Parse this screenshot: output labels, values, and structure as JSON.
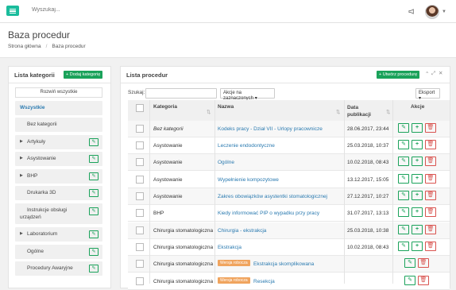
{
  "topbar": {
    "search_placeholder": "Wyszukaj..."
  },
  "page": {
    "title": "Baza procedur",
    "breadcrumbs": [
      "Strona główna",
      "Baza procedur"
    ]
  },
  "categories": {
    "title": "Lista kategorii",
    "add_label": "+ Dodaj kategorię",
    "expand_all": "Rozwiń wszystkie",
    "items": [
      "Wszystkie",
      "Bez kategorii",
      "Artykuły",
      "Asystowanie",
      "BHP",
      "Drukarka 3D",
      "Instrukcje obsługi urządzeń",
      "Laboratorium",
      "Ogólne",
      "Procedury Awaryjne"
    ]
  },
  "procedures": {
    "title": "Lista procedur",
    "create_label": "+ Utwórz procedurę",
    "search_label": "Szukaj:",
    "bulk_label": "Akcje na zaznaczonych",
    "export_label": "Eksport",
    "columns": [
      "Kategoria",
      "Nazwa",
      "Data publikacji",
      "Akcje"
    ],
    "badge_label": "Wersja robocza",
    "rows": [
      {
        "category": "Bez kategorii",
        "name": "Kodeks pracy - Dział VII - Urlopy pracownicze",
        "date": "28.06.2017, 23:44"
      },
      {
        "category": "Asystowanie",
        "name": "Leczenie endodontyczne",
        "date": "25.03.2018, 10:37"
      },
      {
        "category": "Asystowanie",
        "name": "Ogólne",
        "date": "10.02.2018, 08:43"
      },
      {
        "category": "Asystowanie",
        "name": "Wypełnienie kompozytowe",
        "date": "13.12.2017, 15:05"
      },
      {
        "category": "Asystowanie",
        "name": "Zakres obowiązków asystentki stomatologicznej",
        "date": "27.12.2017, 10:27"
      },
      {
        "category": "BHP",
        "name": "Kiedy informować PIP o wypadku przy pracy",
        "date": "31.07.2017, 13:13"
      },
      {
        "category": "Chirurgia stomatologiczna",
        "name": "Chirurgia - ekstrakcja",
        "date": "25.03.2018, 10:38"
      },
      {
        "category": "Chirurgia stomatologiczna",
        "name": "Ekstrakcja",
        "date": "10.02.2018, 08:43"
      },
      {
        "category": "Chirurgia stomatologiczna",
        "name": "Ekstrakcja skomplikowana",
        "date": ""
      },
      {
        "category": "Chirurgia stomatologiczna",
        "name": "Resekcja",
        "date": ""
      }
    ]
  }
}
